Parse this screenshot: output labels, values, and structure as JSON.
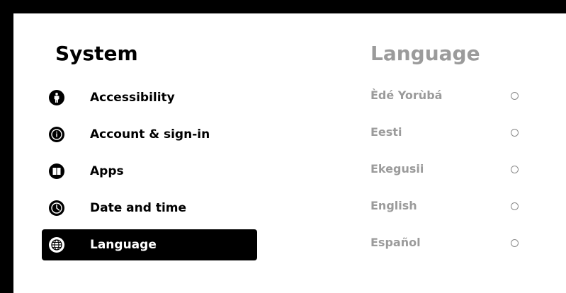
{
  "left_panel": {
    "title": "System",
    "items": [
      {
        "label": "Accessibility",
        "icon": "accessibility-icon",
        "selected": false
      },
      {
        "label": "Account & sign-in",
        "icon": "info-icon",
        "selected": false
      },
      {
        "label": "Apps",
        "icon": "apps-icon",
        "selected": false
      },
      {
        "label": "Date and time",
        "icon": "clock-icon",
        "selected": false
      },
      {
        "label": "Language",
        "icon": "globe-icon",
        "selected": true
      }
    ]
  },
  "right_panel": {
    "title": "Language",
    "options": [
      {
        "label": "Èdé Yorùbá",
        "checked": false
      },
      {
        "label": "Eesti",
        "checked": false
      },
      {
        "label": "Ekegusii",
        "checked": false
      },
      {
        "label": "English",
        "checked": false
      },
      {
        "label": "Español",
        "checked": false
      }
    ]
  },
  "colors": {
    "frame": "#000000",
    "background": "#ffffff",
    "text_primary": "#000000",
    "text_muted": "#9b9b9b",
    "selected_bg": "#000000",
    "selected_text": "#ffffff"
  }
}
